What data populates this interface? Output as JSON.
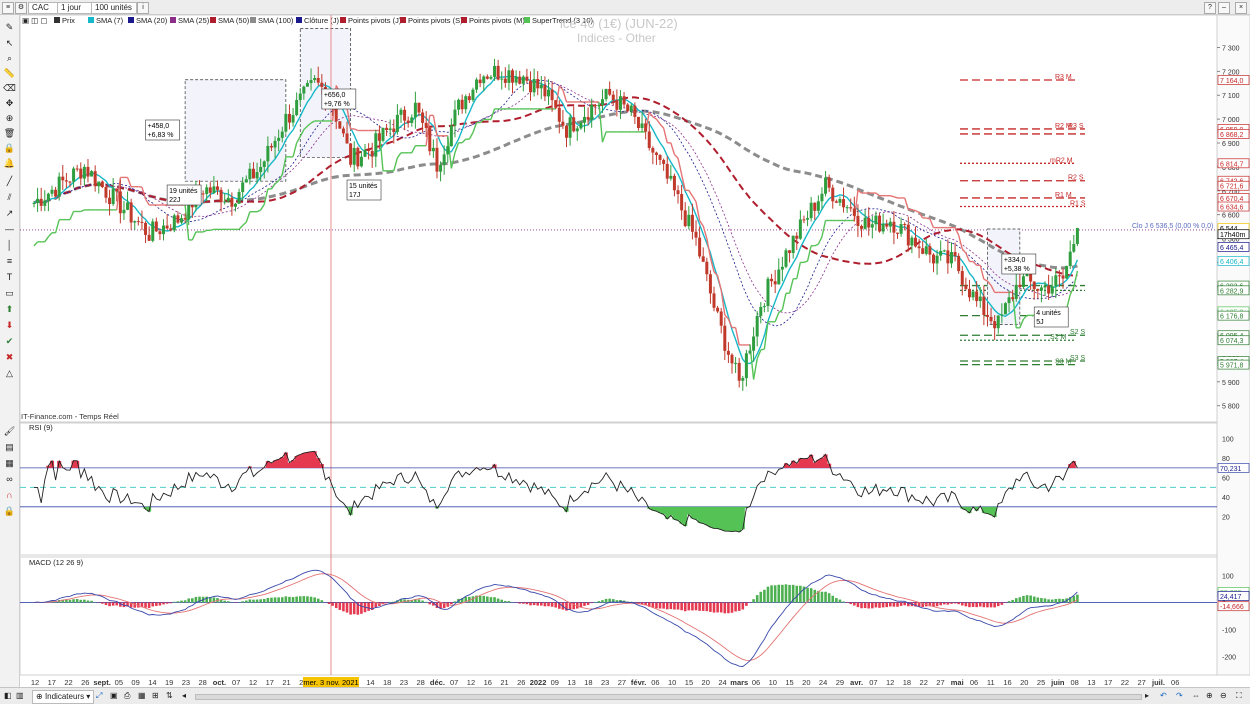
{
  "toolbar": {
    "symbol": "CAC",
    "period": "1 jour",
    "units": "100 unités"
  },
  "legend": [
    {
      "label": "Prix",
      "color": "#333333"
    },
    {
      "label": "SMA (7)",
      "color": "#17b8c8"
    },
    {
      "label": "SMA (20)",
      "color": "#1a1a8c"
    },
    {
      "label": "SMA (25)",
      "color": "#8b2f8b"
    },
    {
      "label": "SMA (50)",
      "color": "#b01e2e"
    },
    {
      "label": "SMA (100)",
      "color": "#8c8c8c"
    },
    {
      "label": "Clôture (J)",
      "color": "#1a1a8c"
    },
    {
      "label": "Points pivots (J)",
      "color": "#b01e2e"
    },
    {
      "label": "Points pivots (S)",
      "color": "#b01e2e"
    },
    {
      "label": "Points pivots (M)",
      "color": "#b01e2e"
    },
    {
      "label": "SuperTrend (3 10)",
      "color": "#55c255"
    }
  ],
  "watermark": {
    "title": "ice 40 (1€) (JUN-22)",
    "subtitle": "Indices - Other"
  },
  "source_label": "IT-Finance.com - Temps Réel",
  "price_axis": [
    {
      "label": "7 300",
      "v": 7300
    },
    {
      "label": "7 200",
      "v": 7200
    },
    {
      "label": "7 100",
      "v": 7100
    },
    {
      "label": "7 000",
      "v": 7000
    },
    {
      "label": "6 900",
      "v": 6900
    },
    {
      "label": "6 800",
      "v": 6800
    },
    {
      "label": "6 700",
      "v": 6700
    },
    {
      "label": "6 600",
      "v": 6600
    },
    {
      "label": "6 500",
      "v": 6500
    },
    {
      "label": "6 400",
      "v": 6400
    },
    {
      "label": "6 300",
      "v": 6300
    },
    {
      "label": "6 200",
      "v": 6200
    },
    {
      "label": "6 100",
      "v": 6100
    },
    {
      "label": "6 000",
      "v": 6000
    },
    {
      "label": "5 900",
      "v": 5900
    },
    {
      "label": "5 800",
      "v": 5800
    }
  ],
  "price_tags": [
    {
      "label": "7 164,0",
      "v": 7164,
      "color": "#c62828"
    },
    {
      "label": "6 959,0",
      "v": 6959,
      "color": "#c62828"
    },
    {
      "label": "6 868,2",
      "v": 6938,
      "color": "#c62828"
    },
    {
      "label": "6 814,7",
      "v": 6815,
      "color": "#c62828"
    },
    {
      "label": "6 742,6",
      "v": 6742,
      "color": "#c62828"
    },
    {
      "label": "6 721,6",
      "v": 6721,
      "color": "#c62828"
    },
    {
      "label": "6 670,4",
      "v": 6670,
      "color": "#c62828"
    },
    {
      "label": "6 634,6",
      "v": 6634,
      "color": "#c62828"
    },
    {
      "label": "6 544",
      "v": 6544,
      "color": "#f2c200"
    },
    {
      "label": "17h40m",
      "v": 6518,
      "color": "#000000"
    },
    {
      "label": "6 465,4",
      "v": 6465,
      "color": "#1a1a8c"
    },
    {
      "label": "6 406,4",
      "v": 6406,
      "color": "#17b8c8"
    },
    {
      "label": "6 303,6",
      "v": 6303,
      "color": "#2e7d32"
    },
    {
      "label": "6 282,9",
      "v": 6283,
      "color": "#2e7d32"
    },
    {
      "label": "6 195,8",
      "v": 6195,
      "color": "#55c255"
    },
    {
      "label": "6 176,8",
      "v": 6177,
      "color": "#2e7d32"
    },
    {
      "label": "6 095,4",
      "v": 6095,
      "color": "#2e7d32"
    },
    {
      "label": "6 074,3",
      "v": 6074,
      "color": "#2e7d32"
    },
    {
      "label": "5 987,4",
      "v": 5987,
      "color": "#2e7d32"
    },
    {
      "label": "5 971,8",
      "v": 5972,
      "color": "#2e7d32"
    }
  ],
  "clo_label": "Clo J 6 536,5 (0,00 % 0,0)",
  "pivot_labels": [
    {
      "label": "R3 M",
      "v": 7164,
      "color": "#c62828"
    },
    {
      "label": "R2 M",
      "v": 6959,
      "color": "#c62828"
    },
    {
      "label": "R3 S",
      "v": 6959,
      "color": "#c62828"
    },
    {
      "label": "mR2 M",
      "v": 6815,
      "color": "#c62828"
    },
    {
      "label": "R2 S",
      "v": 6742,
      "color": "#c62828"
    },
    {
      "label": "R1 M",
      "v": 6670,
      "color": "#c62828"
    },
    {
      "label": "R1 S",
      "v": 6634,
      "color": "#c62828"
    },
    {
      "label": "S2 M",
      "v": 6074,
      "color": "#2e7d32"
    },
    {
      "label": "S2 S",
      "v": 6095,
      "color": "#2e7d32"
    },
    {
      "label": "S3 S",
      "v": 5987,
      "color": "#2e7d32"
    },
    {
      "label": "S3 M",
      "v": 5972,
      "color": "#2e7d32"
    }
  ],
  "annotations": [
    {
      "label": "+458,0",
      "label2": "+6,83 %"
    },
    {
      "label": "19 unités",
      "label2": "22J"
    },
    {
      "label": "+656,0",
      "label2": "+9,76 %"
    },
    {
      "label": "15 unités",
      "label2": "17J"
    },
    {
      "label": "+334,0",
      "label2": "+5,38 %"
    },
    {
      "label": "4 unités",
      "label2": "5J"
    }
  ],
  "rsi": {
    "title": "RSI (9)",
    "value_tag": "70,231",
    "axis": [
      {
        "label": "100",
        "v": 100
      },
      {
        "label": "80",
        "v": 80
      },
      {
        "label": "60",
        "v": 60
      },
      {
        "label": "40",
        "v": 40
      },
      {
        "label": "20",
        "v": 20
      }
    ]
  },
  "macd": {
    "title": "MACD (12 26 9)",
    "tags": [
      {
        "label": "39,082",
        "color": "#55c255"
      },
      {
        "label": "24,417",
        "color": "#1a1a8c"
      },
      {
        "label": "-14,666",
        "color": "#c62828"
      }
    ],
    "axis": [
      {
        "label": "100",
        "v": 100
      },
      {
        "label": "0",
        "v": 0
      },
      {
        "label": "-100",
        "v": -100
      },
      {
        "label": "-200",
        "v": -200
      }
    ]
  },
  "date_axis": [
    "12",
    "17",
    "22",
    "26",
    "sept.",
    "05",
    "09",
    "14",
    "19",
    "23",
    "28",
    "oct.",
    "07",
    "12",
    "17",
    "21",
    "26",
    "nov.",
    "05",
    "09",
    "14",
    "18",
    "23",
    "28",
    "déc.",
    "07",
    "12",
    "16",
    "21",
    "26",
    "2022",
    "09",
    "13",
    "18",
    "23",
    "27",
    "févr.",
    "06",
    "10",
    "15",
    "20",
    "24",
    "mars",
    "06",
    "10",
    "15",
    "20",
    "24",
    "29",
    "avr.",
    "07",
    "12",
    "18",
    "22",
    "27",
    "mai",
    "06",
    "11",
    "16",
    "20",
    "25",
    "juin",
    "08",
    "13",
    "17",
    "22",
    "27",
    "juil.",
    "06"
  ],
  "date_highlight": "mer. 3 nov. 2021",
  "bottom": {
    "indicators_label": "Indicateurs"
  },
  "chart_data": {
    "type": "candlestick",
    "title": "ice 40 (1€) (JUN-22)",
    "ylabel": "",
    "ylim": [
      5740,
      7390
    ],
    "x_range": [
      "2021-08-12",
      "2022-07-06"
    ],
    "start_price": 6650,
    "anchors": [
      [
        0,
        6650
      ],
      [
        14,
        6800
      ],
      [
        20,
        6700
      ],
      [
        32,
        6520
      ],
      [
        40,
        6580
      ],
      [
        47,
        6710
      ],
      [
        55,
        6670
      ],
      [
        63,
        6800
      ],
      [
        70,
        7000
      ],
      [
        78,
        7150
      ],
      [
        82,
        7110
      ],
      [
        88,
        6830
      ],
      [
        94,
        6880
      ],
      [
        100,
        6980
      ],
      [
        106,
        7050
      ],
      [
        112,
        6810
      ],
      [
        118,
        7050
      ],
      [
        124,
        7190
      ],
      [
        130,
        7200
      ],
      [
        136,
        7180
      ],
      [
        142,
        7110
      ],
      [
        148,
        6960
      ],
      [
        154,
        7040
      ],
      [
        160,
        7100
      ],
      [
        166,
        7020
      ],
      [
        172,
        6860
      ],
      [
        178,
        6690
      ],
      [
        184,
        6490
      ],
      [
        190,
        6160
      ],
      [
        196,
        5890
      ],
      [
        202,
        6230
      ],
      [
        208,
        6410
      ],
      [
        214,
        6570
      ],
      [
        220,
        6720
      ],
      [
        226,
        6640
      ],
      [
        232,
        6550
      ],
      [
        238,
        6580
      ],
      [
        244,
        6500
      ],
      [
        250,
        6420
      ],
      [
        256,
        6400
      ],
      [
        262,
        6230
      ],
      [
        268,
        6140
      ],
      [
        274,
        6330
      ],
      [
        280,
        6290
      ],
      [
        286,
        6330
      ],
      [
        290,
        6540
      ]
    ],
    "last_close": 6544,
    "rsi_last": 70.231,
    "macd_last": 24.417,
    "signal_last": 39.082,
    "histogram_last": -14.666
  }
}
